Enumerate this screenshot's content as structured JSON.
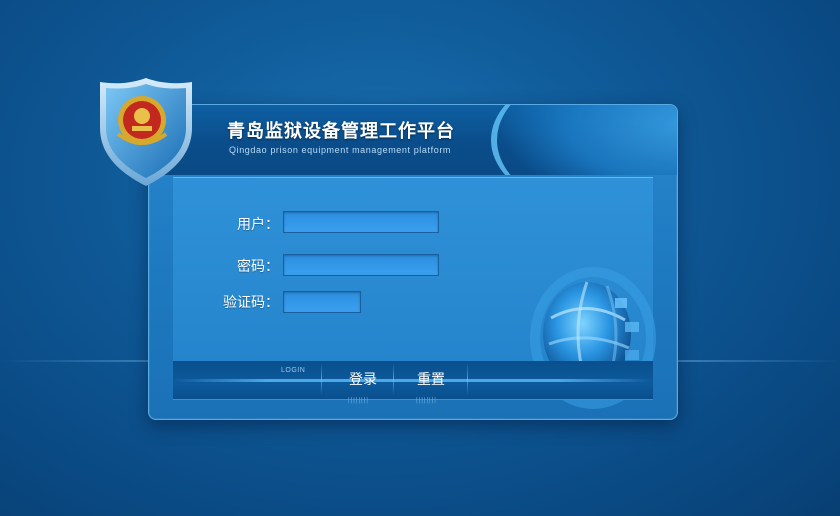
{
  "app": {
    "title": "青岛监狱设备管理工作平台",
    "subtitle": "Qingdao prison equipment management platform"
  },
  "form": {
    "username_label": "用户：",
    "username_value": "",
    "password_label": "密码：",
    "password_value": "",
    "captcha_label": "验证码：",
    "captcha_value": ""
  },
  "footer": {
    "login_tag": "LOGIN",
    "login_button": "登录",
    "reset_button": "重置",
    "ticks": "||||||||"
  },
  "colors": {
    "background": "#0f5a98",
    "panel": "#2585cc",
    "accent": "#5fc0f4"
  },
  "icons": {
    "badge": "police-emblem-shield-icon",
    "globe": "tech-globe-icon"
  }
}
